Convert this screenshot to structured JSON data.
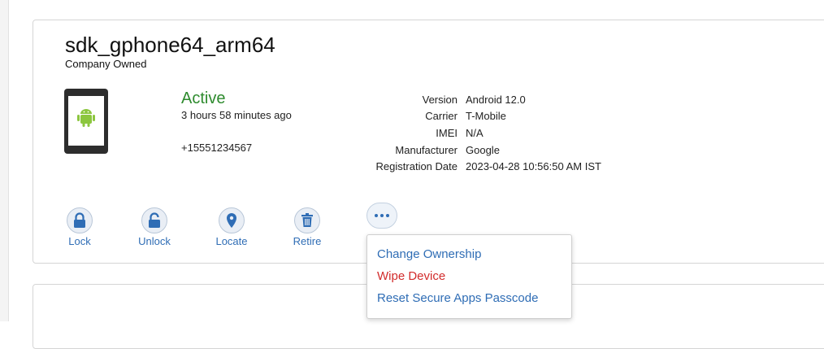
{
  "device": {
    "name": "sdk_gphone64_arm64",
    "ownership": "Company Owned",
    "status": "Active",
    "last_seen": "3 hours 58 minutes ago",
    "phone_number": "+15551234567",
    "platform_icon": "android-icon"
  },
  "details": [
    {
      "label": "Version",
      "value": "Android 12.0"
    },
    {
      "label": "Carrier",
      "value": "T-Mobile"
    },
    {
      "label": "IMEI",
      "value": "N/A"
    },
    {
      "label": "Manufacturer",
      "value": "Google"
    },
    {
      "label": "Registration Date",
      "value": "2023-04-28 10:56:50 AM IST"
    }
  ],
  "actions": {
    "lock": {
      "label": "Lock",
      "icon": "lock-icon"
    },
    "unlock": {
      "label": "Unlock",
      "icon": "unlock-icon"
    },
    "locate": {
      "label": "Locate",
      "icon": "map-pin-icon"
    },
    "retire": {
      "label": "Retire",
      "icon": "trash-icon"
    },
    "more": {
      "icon": "more-icon"
    }
  },
  "menu": {
    "items": [
      {
        "label": "Change Ownership"
      },
      {
        "label": "Wipe Device"
      },
      {
        "label": "Reset Secure Apps Passcode"
      }
    ]
  },
  "colors": {
    "status_active": "#2e8b2e",
    "link": "#2f6db5",
    "danger": "#d22c2c",
    "android": "#8cc63f"
  }
}
